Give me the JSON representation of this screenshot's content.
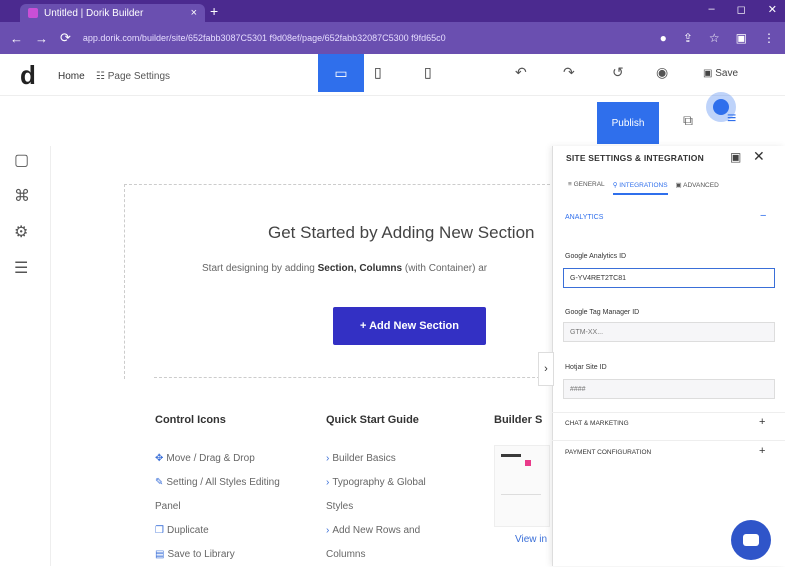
{
  "browser": {
    "tab_title": "Untitled | Dorik Builder",
    "tab_close": "×",
    "new_tab": "+",
    "url": "app.dorik.com/builder/site/652fabb3087C5301 f9d08ef/page/652fabb32087C5300 f9fd65c0",
    "nav": {
      "back": "←",
      "forward": "→",
      "reload": "⟳"
    },
    "window_controls": {
      "minimize": "–",
      "maximize": "◻",
      "close": "✕"
    }
  },
  "toolbar": {
    "logo": "d",
    "home": "Home",
    "page_settings": "Page Settings",
    "desktop_icon": "desktop-icon",
    "tablet_icon": "tablet-icon",
    "mobile_icon": "mobile-icon",
    "save": "Save",
    "publish": "Publish"
  },
  "canvas": {
    "headline": "Get Started by Adding New Section",
    "subline_pre": "Start designing by adding ",
    "subline_bold": "Section, Columns",
    "subline_post": " (with Container) ar",
    "add_button": "+ Add New Section",
    "columns": [
      {
        "title": "Control Icons",
        "items": [
          "Move / Drag & Drop",
          "Setting / All Styles Editing",
          "Panel",
          "Duplicate",
          "Save to Library"
        ]
      },
      {
        "title": "Quick Start Guide",
        "items": [
          "Builder Basics",
          "Typography & Global",
          "Styles",
          "Add New Rows and",
          "Columns"
        ]
      },
      {
        "title": "Builder S"
      }
    ],
    "view_link": "View in"
  },
  "panel": {
    "title": "SITE SETTINGS & INTEGRATION",
    "tabs": [
      "GENERAL",
      "INTEGRATIONS",
      "ADVANCED"
    ],
    "analytics": {
      "label": "ANALYTICS",
      "toggle": "−",
      "fields": [
        {
          "label": "Google Analytics ID",
          "value": "G-YV4RET2TC81",
          "placeholder": ""
        },
        {
          "label": "Google Tag Manager ID",
          "value": "",
          "placeholder": "GTM-XX..."
        },
        {
          "label": "Hotjar Site ID",
          "value": "",
          "placeholder": "####"
        }
      ]
    },
    "sections": [
      {
        "label": "CHAT & MARKETING",
        "toggle": "+"
      },
      {
        "label": "PAYMENT CONFIGURATION",
        "toggle": "+"
      }
    ]
  },
  "colors": {
    "brand_purple": "#4b2a8f",
    "primary_blue": "#2f6fec",
    "cta_indigo": "#3330c4"
  }
}
